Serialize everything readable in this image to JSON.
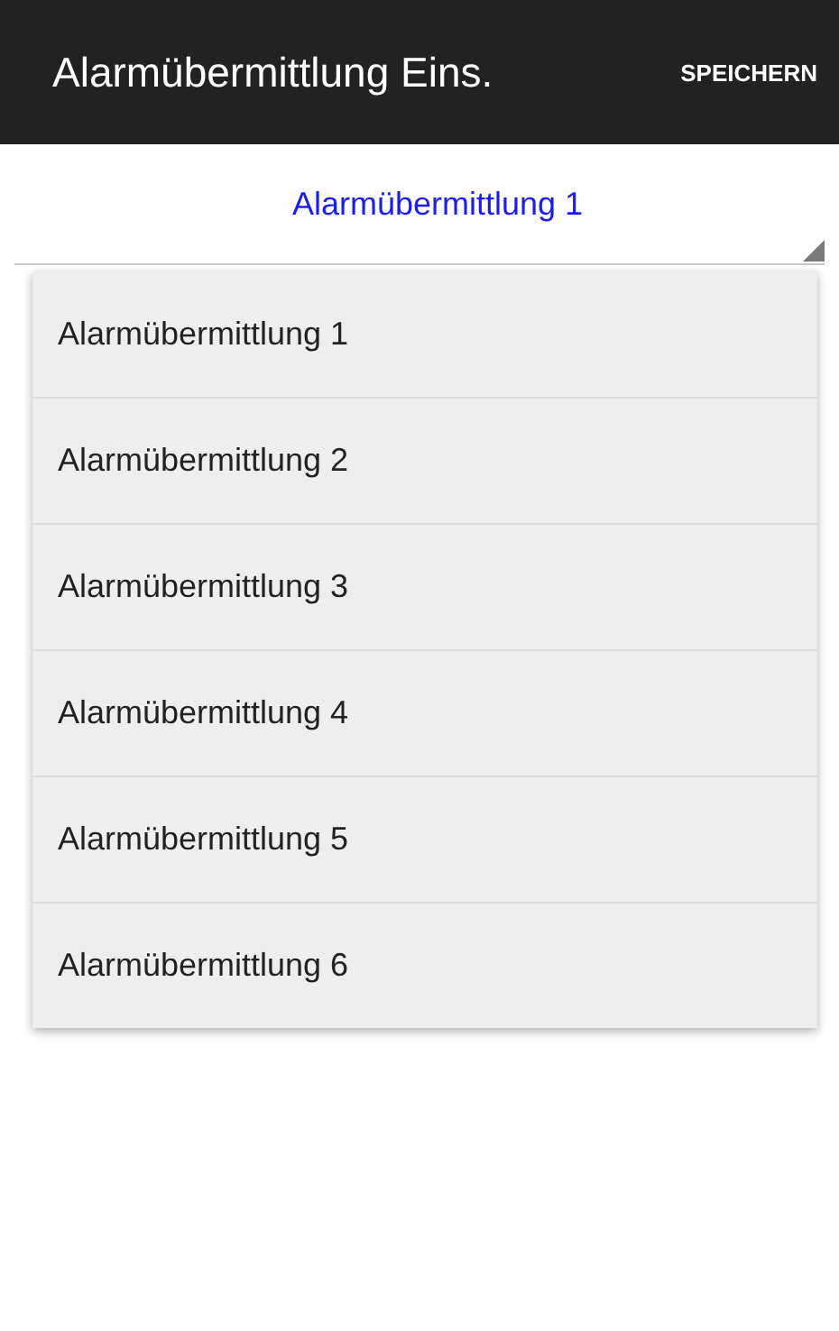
{
  "app_bar": {
    "title": "Alarmübermittlung Eins.",
    "action": "SPEICHERN"
  },
  "spinner": {
    "value": "Alarmübermittlung 1"
  },
  "dropdown": {
    "items": [
      {
        "label": "Alarmübermittlung 1"
      },
      {
        "label": "Alarmübermittlung 2"
      },
      {
        "label": "Alarmübermittlung 3"
      },
      {
        "label": "Alarmübermittlung 4"
      },
      {
        "label": "Alarmübermittlung 5"
      },
      {
        "label": "Alarmübermittlung 6"
      }
    ]
  }
}
